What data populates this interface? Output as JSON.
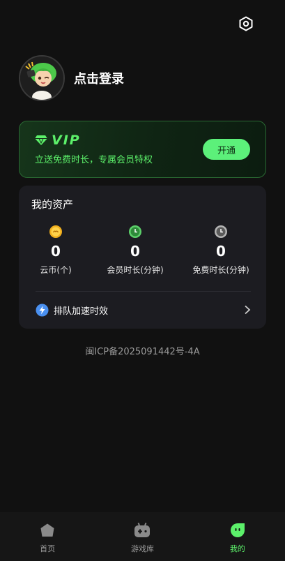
{
  "header": {
    "settings_icon": "gear-hexagon-icon"
  },
  "profile": {
    "login_text": "点击登录",
    "avatar_icon": "cartoon-avatar"
  },
  "vip": {
    "title": "VIP",
    "subtitle": "立送免费时长，专属会员特权",
    "button_label": "开通",
    "accent": "#5cf06a"
  },
  "assets": {
    "title": "我的资产",
    "stats": [
      {
        "value": "0",
        "label": "云币(个)",
        "icon": "coin-icon"
      },
      {
        "value": "0",
        "label": "会员时长(分钟)",
        "icon": "green-clock-icon"
      },
      {
        "value": "0",
        "label": "免费时长(分钟)",
        "icon": "gray-clock-icon"
      }
    ],
    "queue_label": "排队加速时效"
  },
  "footer": {
    "icp": "闽ICP备2025091442号-4A"
  },
  "tabs": [
    {
      "label": "首页",
      "icon": "home-icon"
    },
    {
      "label": "游戏库",
      "icon": "gamepad-icon"
    },
    {
      "label": "我的",
      "icon": "profile-face-icon",
      "active": true
    }
  ]
}
